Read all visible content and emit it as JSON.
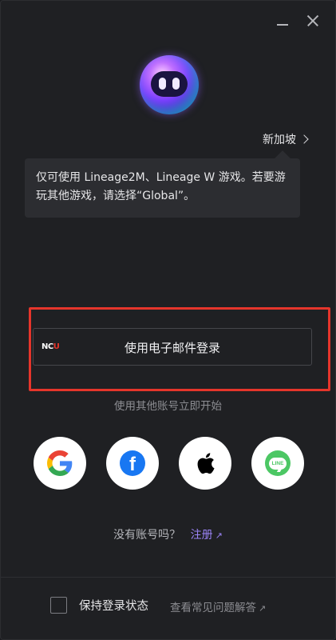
{
  "window_controls": {
    "minimize_icon": "minimize-icon",
    "close_icon": "close-icon"
  },
  "mascot": {
    "icon": "purple-orb-mascot"
  },
  "region": {
    "label": "新加坡",
    "icon": "chevron-right-icon"
  },
  "tooltip": {
    "text": "仅可使用 Lineage2M、Lineage W 游戏。若要游玩其他游戏，请选择“Global”。"
  },
  "email_login": {
    "logo_text": "NC",
    "logo_accent": "U",
    "label": "使用电子邮件登录",
    "highlight_color": "#e5352b"
  },
  "alternative": {
    "label": "使用其他账号立即开始"
  },
  "social_logins": [
    {
      "name": "Google",
      "icon": "google-icon"
    },
    {
      "name": "Facebook",
      "icon": "facebook-icon"
    },
    {
      "name": "Apple",
      "icon": "apple-icon"
    },
    {
      "name": "LINE",
      "icon": "line-icon",
      "icon_text": "LINE"
    }
  ],
  "signup": {
    "prompt": "没有账号吗？",
    "link": "注册",
    "arrow": "↗"
  },
  "footer": {
    "keep_logged_in": "保持登录状态",
    "faq": "查看常见问题解答",
    "faq_arrow": "↗"
  },
  "colors": {
    "background": "#1f2023",
    "accent_link": "#9b84f7",
    "facebook": "#1877f2",
    "line": "#4cc764"
  }
}
